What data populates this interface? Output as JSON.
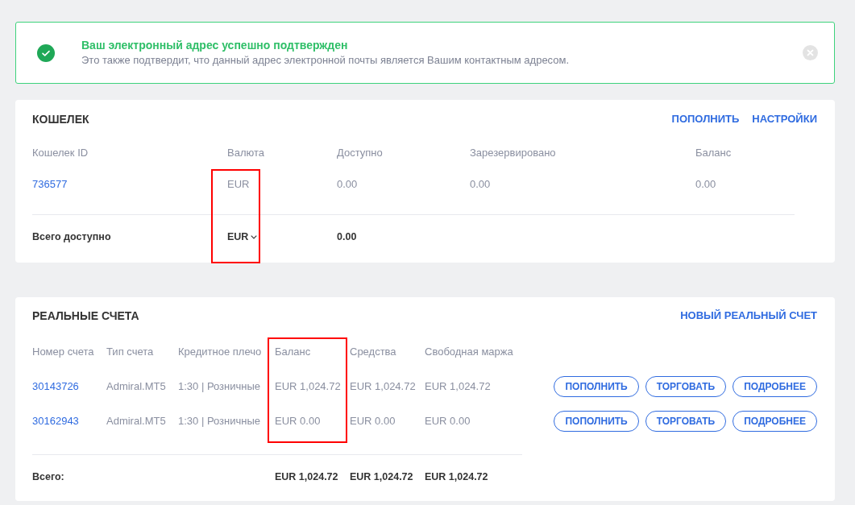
{
  "alert": {
    "title": "Ваш электронный адрес успешно подтвержден",
    "message": "Это также подтвердит, что данный адрес электронной почты является Вашим контактным адресом.",
    "dismissible": true
  },
  "wallet": {
    "title": "КОШЕЛЕК",
    "actions": [
      "ПОПОЛНИТЬ",
      "НАСТРОЙКИ"
    ],
    "columns": [
      {
        "label": "Кошелек ID",
        "highlighted": false
      },
      {
        "label": "Валюта",
        "highlighted": true
      },
      {
        "label": "Доступно",
        "highlighted": false
      },
      {
        "label": "Зарезервировано",
        "highlighted": false
      },
      {
        "label": "Баланс",
        "highlighted": false
      }
    ],
    "rows": [
      [
        "736577",
        "EUR",
        "0.00",
        "0.00",
        "0.00"
      ]
    ],
    "total": {
      "label": "Всего доступно",
      "currency": "EUR",
      "amount": "0.00"
    }
  },
  "real_accounts": {
    "title": "РЕАЛЬНЫЕ СЧЕТА",
    "actions": [
      "НОВЫЙ РЕАЛЬНЫЙ СЧЕТ"
    ],
    "columns": [
      {
        "label": "Номер счета",
        "highlighted": false
      },
      {
        "label": "Тип счета",
        "highlighted": false
      },
      {
        "label": "Кредитное плечо",
        "highlighted": false
      },
      {
        "label": "Баланс",
        "highlighted": true
      },
      {
        "label": "Средства",
        "highlighted": false
      },
      {
        "label": "Свободная маржа",
        "highlighted": false
      }
    ],
    "rows": [
      {
        "cells": [
          "30143726",
          "Admiral.MT5",
          "1:30 | Розничные",
          "EUR 1,024.72",
          "EUR 1,024.72",
          "EUR 1,024.72"
        ],
        "buttons": [
          "ПОПОЛНИТЬ",
          "ТОРГОВАТЬ",
          "ПОДРОБНЕЕ"
        ]
      },
      {
        "cells": [
          "30162943",
          "Admiral.MT5",
          "1:30 | Розничные",
          "EUR 0.00",
          "EUR 0.00",
          "EUR 0.00"
        ],
        "buttons": [
          "ПОПОЛНИТЬ",
          "ТОРГОВАТЬ",
          "ПОДРОБНЕЕ"
        ]
      }
    ],
    "total": {
      "label": "Всего:",
      "values": [
        "EUR 1,024.72",
        "EUR 1,024.72",
        "EUR 1,024.72"
      ]
    }
  }
}
